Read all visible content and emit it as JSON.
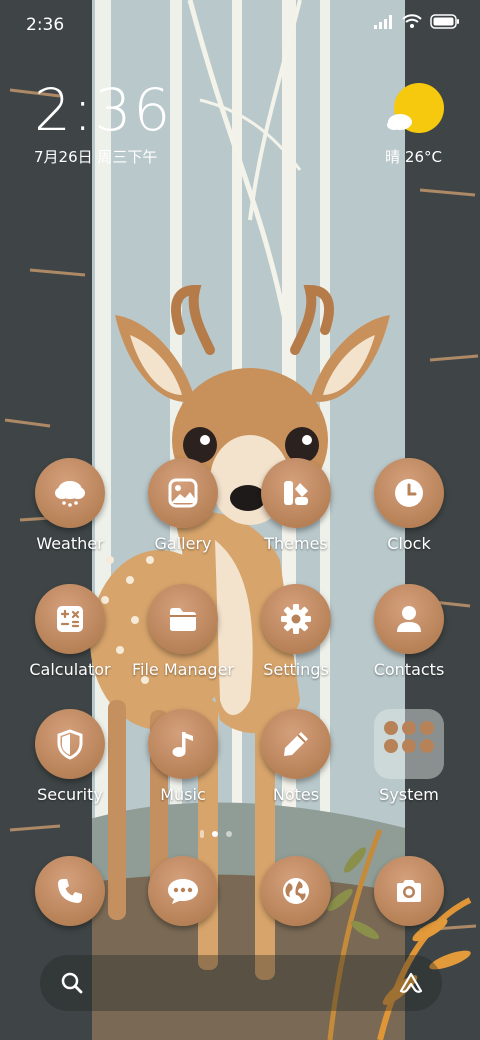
{
  "status_bar": {
    "time": "2:36",
    "icons": [
      "signal-icon",
      "wifi-icon",
      "battery-icon"
    ]
  },
  "clock_widget": {
    "time": "2:36",
    "date": "7月26日 周三下午"
  },
  "weather_widget": {
    "text": "晴 26°C",
    "icon": "sun-cloud-icon",
    "sun_color": "#f6c90e"
  },
  "apps": [
    {
      "label": "Weather",
      "icon": "cloud-rain-icon"
    },
    {
      "label": "Gallery",
      "icon": "picture-icon"
    },
    {
      "label": "Themes",
      "icon": "themes-icon"
    },
    {
      "label": "Clock",
      "icon": "clock-icon"
    },
    {
      "label": "Calculator",
      "icon": "calculator-icon"
    },
    {
      "label": "File Manager",
      "icon": "folder-icon"
    },
    {
      "label": "Settings",
      "icon": "gear-icon"
    },
    {
      "label": "Contacts",
      "icon": "person-icon"
    },
    {
      "label": "Security",
      "icon": "shield-icon"
    },
    {
      "label": "Music",
      "icon": "music-note-icon"
    },
    {
      "label": "Notes",
      "icon": "pencil-icon"
    },
    {
      "label": "System",
      "icon": "folder-grid-icon"
    }
  ],
  "dock": [
    {
      "icon": "phone-icon"
    },
    {
      "icon": "message-icon"
    },
    {
      "icon": "browser-globe-icon"
    },
    {
      "icon": "camera-icon"
    }
  ],
  "page_indicator": {
    "pages": 3,
    "active": 2
  },
  "search_bar": {
    "left_icon": "search-icon",
    "right_icon": "assistant-icon"
  },
  "colors": {
    "icon_brown": "#b88258",
    "wallpaper_sky": "#b9c8cb",
    "trunk": "#3f4546"
  }
}
